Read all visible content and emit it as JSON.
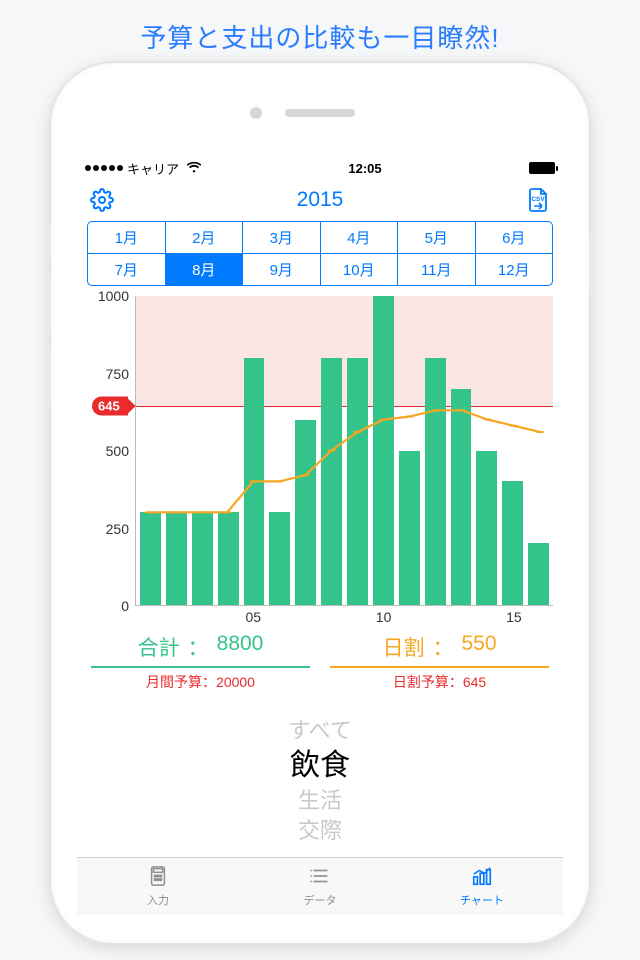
{
  "marketing_tagline": "予算と支出の比較も一目瞭然!",
  "status": {
    "carrier": "キャリア",
    "time": "12:05"
  },
  "header": {
    "year": "2015"
  },
  "months": {
    "labels": [
      "1月",
      "2月",
      "3月",
      "4月",
      "5月",
      "6月",
      "7月",
      "8月",
      "9月",
      "10月",
      "11月",
      "12月"
    ],
    "selected_index": 7
  },
  "summary": {
    "total": {
      "label": "合計",
      "value": "8800",
      "budget_label": "月間予算",
      "budget_value": "20000"
    },
    "daily": {
      "label": "日割",
      "value": "550",
      "budget_label": "日割予算",
      "budget_value": "645"
    }
  },
  "threshold": {
    "value": 645,
    "label": "645"
  },
  "picker": {
    "options": [
      "すべて",
      "飲食",
      "生活",
      "交際"
    ],
    "selected_index": 1
  },
  "tabs": {
    "items": [
      {
        "id": "input",
        "label": "入力"
      },
      {
        "id": "data",
        "label": "データ"
      },
      {
        "id": "chart",
        "label": "チャート"
      }
    ],
    "active_index": 2
  },
  "chart_data": {
    "type": "bar+line",
    "ylim": [
      0,
      1000
    ],
    "yticks": [
      0,
      250,
      500,
      750,
      1000
    ],
    "xticks": [
      5,
      10,
      15
    ],
    "threshold": 645,
    "days": [
      1,
      2,
      3,
      4,
      5,
      6,
      7,
      8,
      9,
      10,
      11,
      12,
      13,
      14,
      15,
      16
    ],
    "bars": [
      300,
      300,
      300,
      300,
      800,
      300,
      600,
      800,
      800,
      1000,
      500,
      800,
      700,
      500,
      400,
      200
    ],
    "line": [
      300,
      300,
      300,
      300,
      400,
      400,
      420,
      500,
      560,
      600,
      610,
      630,
      630,
      600,
      580,
      560
    ]
  }
}
